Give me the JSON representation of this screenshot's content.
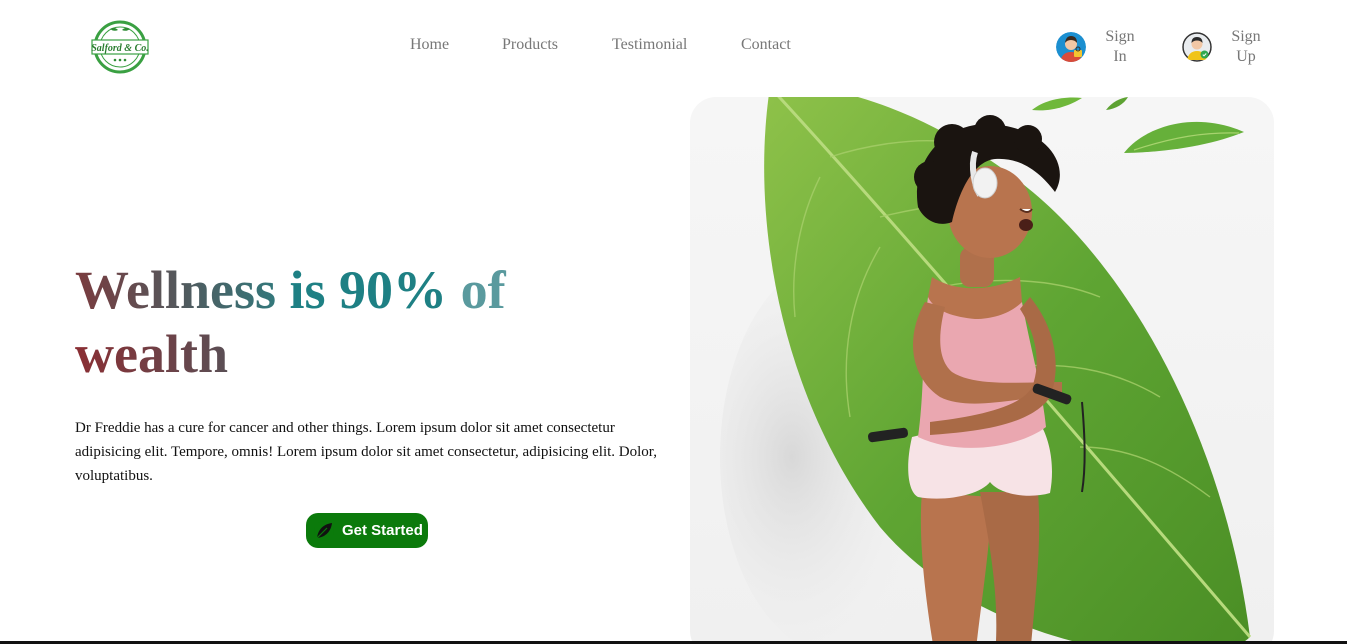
{
  "brand": {
    "logo_icon": "salford-logo",
    "name": "Salford & Co."
  },
  "nav": {
    "items": [
      {
        "label": "Home"
      },
      {
        "label": "Products"
      },
      {
        "label": "Testimonial"
      },
      {
        "label": "Contact"
      }
    ]
  },
  "auth": {
    "signin": {
      "line1": "Sign",
      "line2": "In",
      "icon": "user-signin-icon"
    },
    "signup": {
      "line1": "Sign",
      "line2": "Up",
      "icon": "user-signup-icon"
    }
  },
  "hero": {
    "headline_part1": "Wellness ",
    "headline_part2": "is 90% ",
    "headline_part3": "of",
    "headline_part4": "wealth",
    "description": "Dr Freddie has a cure for cancer and other things. Lorem ipsum dolor sit amet consectetur adipisicing elit. Tempore, omnis! Lorem ipsum dolor sit amet consectetur, adipisicing elit. Dolor, voluptatibus.",
    "cta_label": "Get Started",
    "cta_icon": "leaf-icon",
    "image": "woman-with-jump-rope-and-leaf"
  },
  "colors": {
    "accent_green": "#0b7a0b",
    "teal": "#1e8084",
    "maroon": "#8a2e33",
    "nav_text": "#777777"
  }
}
